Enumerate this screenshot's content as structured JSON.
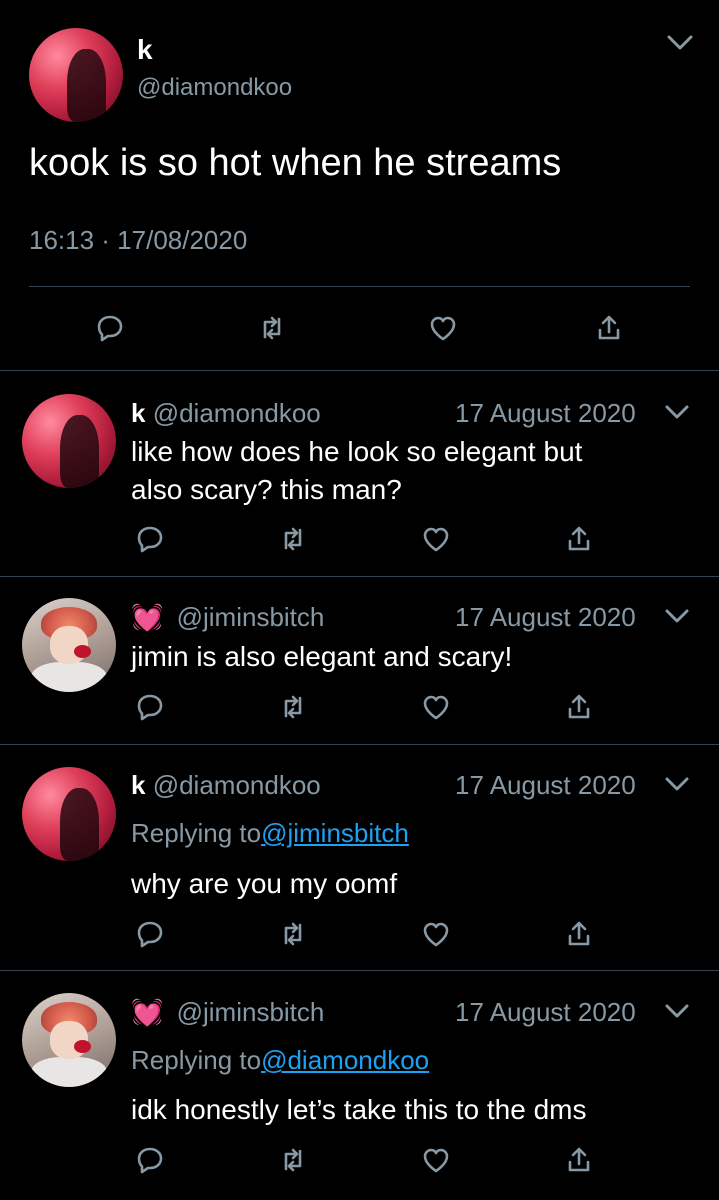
{
  "main_tweet": {
    "name": "k",
    "handle": "@diamondkoo",
    "text": "kook is so hot when he streams",
    "timestamp": "16:13 · 17/08/2020"
  },
  "replies": [
    {
      "name": "k",
      "handle": "@diamondkoo",
      "date": "17 August 2020",
      "text_line1": "like how does he look so elegant but",
      "text_line2": "also scary? this man?"
    },
    {
      "name_emoji": "💓",
      "handle": "@jiminsbitch",
      "date": "17 August 2020",
      "text": "jimin is also elegant and scary!"
    },
    {
      "name": "k",
      "handle": "@diamondkoo",
      "date": "17 August 2020",
      "replying_prefix": "Replying to",
      "replying_to": "@jiminsbitch",
      "text": "why are you my oomf"
    },
    {
      "name_emoji": "💓",
      "handle": "@jiminsbitch",
      "date": "17 August 2020",
      "replying_prefix": "Replying to",
      "replying_to": "@diamondkoo",
      "text": "idk honestly let’s take this to the dms"
    }
  ],
  "icons": [
    "reply-icon",
    "retweet-icon",
    "like-icon",
    "share-icon",
    "chevron-down-icon"
  ],
  "colors": {
    "background": "#000000",
    "text": "#ffffff",
    "secondary": "#8899a6",
    "link": "#1da1f2",
    "divider": "#38444d"
  }
}
